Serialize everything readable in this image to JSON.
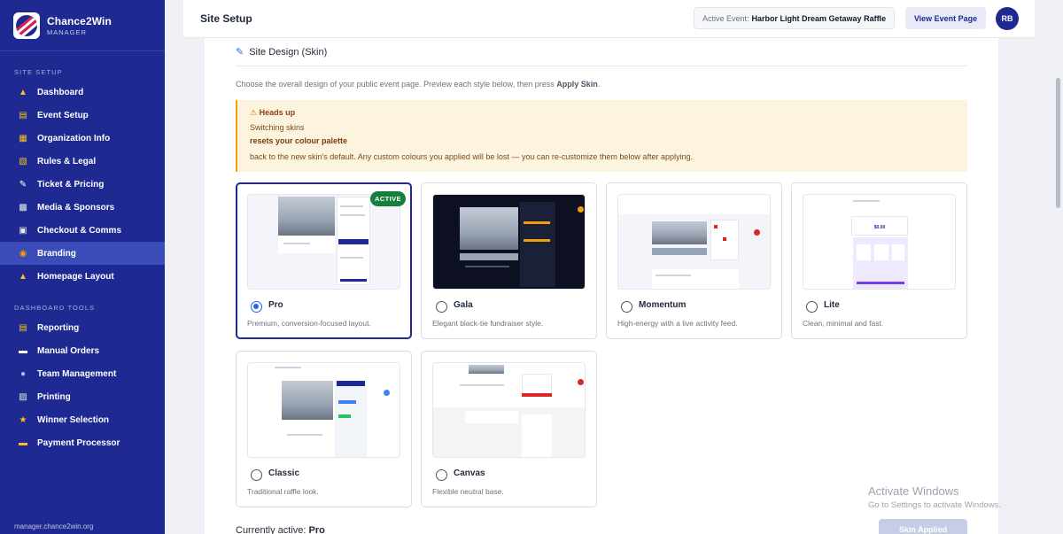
{
  "app": {
    "name": "Chance2Win",
    "subtitle": "MANAGER",
    "footer": "manager.chance2win.org"
  },
  "sidebar": {
    "site_setup_label": "SITE SETUP",
    "tools_label": "DASHBOARD TOOLS",
    "site_setup_items": [
      {
        "label": "Dashboard",
        "icon": "home-icon"
      },
      {
        "label": "Event Setup",
        "icon": "document-icon"
      },
      {
        "label": "Organization Info",
        "icon": "building-icon"
      },
      {
        "label": "Rules & Legal",
        "icon": "scroll-icon"
      },
      {
        "label": "Ticket & Pricing",
        "icon": "pencil-icon"
      },
      {
        "label": "Media & Sponsors",
        "icon": "image-icon"
      },
      {
        "label": "Checkout & Comms",
        "icon": "cart-icon"
      },
      {
        "label": "Branding",
        "icon": "palette-icon",
        "active": true
      },
      {
        "label": "Homepage Layout",
        "icon": "home-icon"
      }
    ],
    "tool_items": [
      {
        "label": "Reporting",
        "icon": "chart-icon"
      },
      {
        "label": "Manual Orders",
        "icon": "minus-icon"
      },
      {
        "label": "Team Management",
        "icon": "team-icon"
      },
      {
        "label": "Printing",
        "icon": "printer-icon"
      },
      {
        "label": "Winner Selection",
        "icon": "trophy-icon"
      },
      {
        "label": "Payment Processor",
        "icon": "card-icon"
      }
    ]
  },
  "topbar": {
    "title": "Site Setup",
    "active_event_label": "Active Event:",
    "active_event_name": "Harbor Light Dream Getaway Raffle",
    "view_button": "View Event Page",
    "avatar_initials": "RB"
  },
  "section": {
    "heading": "Site Design (Skin)",
    "intro_prefix": "Choose the overall design of your public event page. Preview each style below, then press",
    "intro_action": "Apply Skin",
    "intro_suffix": "."
  },
  "alert": {
    "title": "Heads up",
    "line1": "Switching skins",
    "line2": "resets your colour palette",
    "line3": "back to the new skin's default. Any custom colours you applied will be lost — you can re-customize them below after applying."
  },
  "skins": [
    {
      "name": "Pro",
      "description": "Premium, conversion-focused layout.",
      "selected": true,
      "badge": "ACTIVE"
    },
    {
      "name": "Gala",
      "description": "Elegant black-tie fundraiser style.",
      "selected": false
    },
    {
      "name": "Momentum",
      "description": "High-energy with a live activity feed.",
      "selected": false
    },
    {
      "name": "Lite",
      "description": "Clean, minimal and fast.",
      "selected": false
    },
    {
      "name": "Classic",
      "description": "Traditional raffle look.",
      "selected": false
    },
    {
      "name": "Canvas",
      "description": "Flexible neutral base.",
      "selected": false
    }
  ],
  "lite_price": "$0.00",
  "footer": {
    "currently_label": "Currently active:",
    "currently_value": "Pro",
    "apply_button": "Skin Applied"
  },
  "watermark": {
    "line1": "Activate Windows",
    "line2": "Go to Settings to activate Windows."
  },
  "colors": {
    "sidebar": "#1e2a91",
    "active_badge": "#15803d",
    "alert_bg": "#fdf4e0",
    "alert_border": "#f59e0b",
    "radio": "#2563eb"
  }
}
